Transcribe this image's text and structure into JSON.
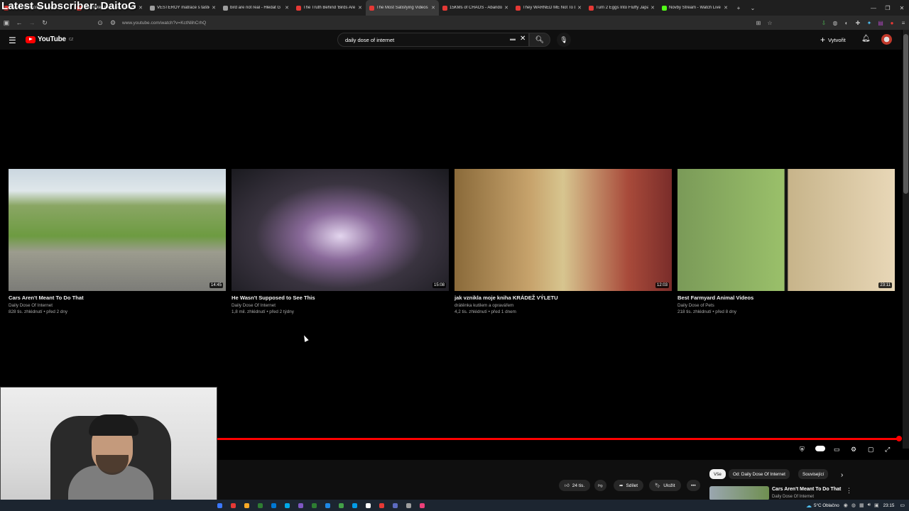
{
  "stream_overlay": {
    "latest_subscriber": "Latest Subscriber: DaitoG"
  },
  "browser": {
    "tabs": [
      {
        "label": "Latest Subscriber: DaitoG",
        "color": "#e53935",
        "active": false
      },
      {
        "label": "Attempted the Creb Track. I",
        "color": "#e53935",
        "active": false
      },
      {
        "label": "VESTERÖY matrace s taštič",
        "color": "#9e9e9e",
        "active": false
      },
      {
        "label": "bird are not real - Hledat G",
        "color": "#9e9e9e",
        "active": false
      },
      {
        "label": "The Truth Behind 'Birds Are",
        "color": "#e53935",
        "active": false
      },
      {
        "label": "The Most Satisfying Videos",
        "color": "#e53935",
        "active": true
      },
      {
        "label": "15KMs of CHAOS - Abando",
        "color": "#e53935",
        "active": false
      },
      {
        "label": "They WARNED ME Not To D",
        "color": "#e53935",
        "active": false
      },
      {
        "label": "Turn 2 Eggs Into Fluffy Japa",
        "color": "#e53935",
        "active": false
      },
      {
        "label": "Novby Stream - Watch Live",
        "color": "#53fc18",
        "active": false
      }
    ],
    "url": "www.youtube.com/watch?v=KctNlihCrhQ"
  },
  "youtube": {
    "logo_text": "YouTube",
    "logo_region": "CZ",
    "search_value": "daily dose of internet",
    "create_label": "Vytvořit"
  },
  "end_screen": [
    {
      "title": "Cars Aren't Meant To Do That",
      "channel": "Daily Dose Of Internet",
      "meta": "828 tis. zhlédnutí • před 2 dny",
      "duration": "14:45"
    },
    {
      "title": "He Wasn't Supposed to See This",
      "channel": "Daily Dose Of Internet",
      "meta": "1,8 mil. zhlédnutí • před 2 týdny",
      "duration": "15:08"
    },
    {
      "title": "jak vznikla moje kniha KRÁDEŽ VÝLETU",
      "channel": "drátěnka kutilem a opravářem",
      "meta": "4,2 tis. zhlédnutí • před 1 dnem",
      "duration": "12:03"
    },
    {
      "title": "Best Farmyard Animal Videos",
      "channel": "Daily Dose of Pets",
      "meta": "218 tis. zhlédnutí • před 8 dny",
      "duration": "23:11"
    }
  ],
  "player": {
    "progress_fraction": 0.995
  },
  "below_player": {
    "like_count": "24 tis.",
    "share_label": "Sdílet",
    "save_label": "Uložit",
    "more_label": "•••",
    "chips": [
      {
        "label": "Vše",
        "selected": true
      },
      {
        "label": "Od: Daily Dose Of Internet",
        "selected": false
      },
      {
        "label": "Související",
        "selected": false
      }
    ],
    "side_video": {
      "title": "Cars Aren't Meant To Do That",
      "channel": "Daily Dose Of Internet"
    }
  },
  "taskbar": {
    "weather": "5°C  Oblačno",
    "time": "23:15",
    "app_colors": [
      "#3b78ff",
      "#e53935",
      "#f9a825",
      "#2e7d32",
      "#0078d4",
      "#00a8e8",
      "#7e57c2",
      "#2e7d32",
      "#1e88e5",
      "#43a047",
      "#039be5",
      "#ffffff",
      "#e53935",
      "#5c6bc0",
      "#9e9e9e",
      "#ec407a"
    ]
  }
}
